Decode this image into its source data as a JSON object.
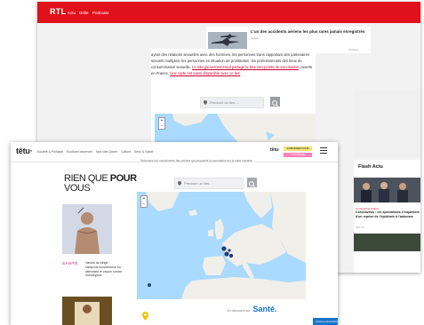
{
  "colors": {
    "rtl_red": "#e1111b",
    "tetu_pink": "#e0007a",
    "link_red": "#cc0033",
    "sante_blue": "#1a73c9",
    "map_water": "#aadaff",
    "map_land": "#f1efe9"
  },
  "rtl": {
    "logo": "RTL",
    "nav": [
      "Actu",
      "Grille",
      "Podcasts"
    ],
    "ad": {
      "title": "L'un des accidents aériens les plus rares jamais enregistrés",
      "source": "Gaedo"
    },
    "sponsor": "Outbrain",
    "body_text": "ayant des relations sexuelles avec des hommes, les personnes trans rapportant des partenaires sexuels multiples, les personnes en situation de prostitution, les professionnels des lieux de consommation sexuelle.",
    "link1": "Le site gouvernemental partage la liste des points de vaccination",
    "mid_text": "ouverts en France.",
    "link2": "Une carte est aussi disponible avec ce lien",
    "search_placeholder": "Précisez un lieu...",
    "flash": {
      "title": "Flash Actu",
      "category": "Coronavirus France",
      "headline": "Coronavirus : les spécialistes s'inquiètent d'un reprise de l'épidémie à l'automne",
      "time": "RTL 1h"
    }
  },
  "tetu": {
    "logo": "têtu·",
    "nav": [
      "Société & Politique",
      "Éculturel observée",
      "Nos vies Queer",
      "Culture",
      "Sexo & Santé"
    ],
    "logo_small": "têtu·",
    "btn_subscribe": "S'ABONNER POUR",
    "btn_donate": "S'INFORMER",
    "intro": "Retrouvez les coordonnées des centres qui proposent la vaccination sur la carte suivante",
    "rqpv": {
      "line1a": "RIEN QUE ",
      "line1b": "POUR",
      "line2": "VOUS"
    },
    "sante_label": "SANTÉ",
    "story": "Variole du singe : l'absurde incohérence en attendant le vaccin contre monkeypox",
    "search_placeholder": "Précisez un lieu...",
    "footer_label": "En découvrir sur",
    "footer_brand": "Santé.",
    "chip": "Centres vaccination"
  }
}
